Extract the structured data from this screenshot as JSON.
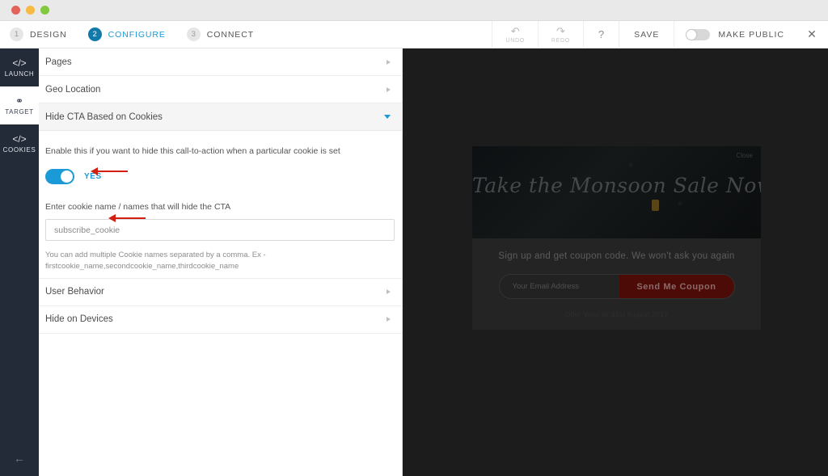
{
  "window": {
    "traffic_lights": [
      "close",
      "minimize",
      "zoom"
    ]
  },
  "header": {
    "steps": [
      {
        "number": "1",
        "label": "DESIGN",
        "active": false
      },
      {
        "number": "2",
        "label": "CONFIGURE",
        "active": true
      },
      {
        "number": "3",
        "label": "CONNECT",
        "active": false
      }
    ],
    "toolbar": {
      "undo_label": "UNDO",
      "undo_icon": "undo-arrow-icon",
      "redo_label": "REDO",
      "redo_icon": "redo-arrow-icon",
      "help_label": "?",
      "save_label": "SAVE",
      "make_public_label": "MAKE PUBLIC",
      "make_public_state": "off",
      "close_label": "✕"
    }
  },
  "sidebar": {
    "items": [
      {
        "label": "LAUNCH",
        "icon": "code-icon",
        "active": false
      },
      {
        "label": "TARGET",
        "icon": "person-icon",
        "active": true
      },
      {
        "label": "COOKIES",
        "icon": "code-icon",
        "active": false
      }
    ],
    "back_icon": "back-arrow-icon"
  },
  "panel": {
    "rows": [
      {
        "label": "Pages",
        "expanded": false
      },
      {
        "label": "Geo Location",
        "expanded": false
      },
      {
        "label": "Hide CTA Based on Cookies",
        "expanded": true
      }
    ],
    "rows_after": [
      {
        "label": "User Behavior",
        "expanded": false
      },
      {
        "label": "Hide on Devices",
        "expanded": false
      }
    ],
    "expanded_section": {
      "description": "Enable this if you want to hide this call-to-action when a particular cookie is set",
      "toggle_state": "on",
      "toggle_label": "YES",
      "field_label": "Enter cookie name / names that will hide the CTA",
      "field_value": "subscribe_cookie",
      "field_placeholder": "subscribe_cookie",
      "helper_text": "You can add multiple Cookie names separated by a comma. Ex - firstcookie_name,secondcookie_name,thirdcookie_name"
    }
  },
  "annotations": {
    "arrow_color": "#d31f12",
    "arrow_toggle": "points-at-toggle",
    "arrow_input": "points-at-cookie-input"
  },
  "preview": {
    "banner": {
      "close_label": "Close",
      "title": "Take the Monsoon Sale Now!"
    },
    "headline": "Sign up and get coupon code. We won't ask you again",
    "email_placeholder": "Your Email Address",
    "submit_label": "Send Me Coupon",
    "footer": "Offer Valid till 31st August 2017"
  },
  "colors": {
    "accent_blue": "#1a9ad7",
    "step_active": "#1279ab",
    "sidebar_dark": "#232a38",
    "preview_bg": "#1c1c1c",
    "cta_button_red": "#4d0b08",
    "annotation_red": "#d31f12"
  }
}
